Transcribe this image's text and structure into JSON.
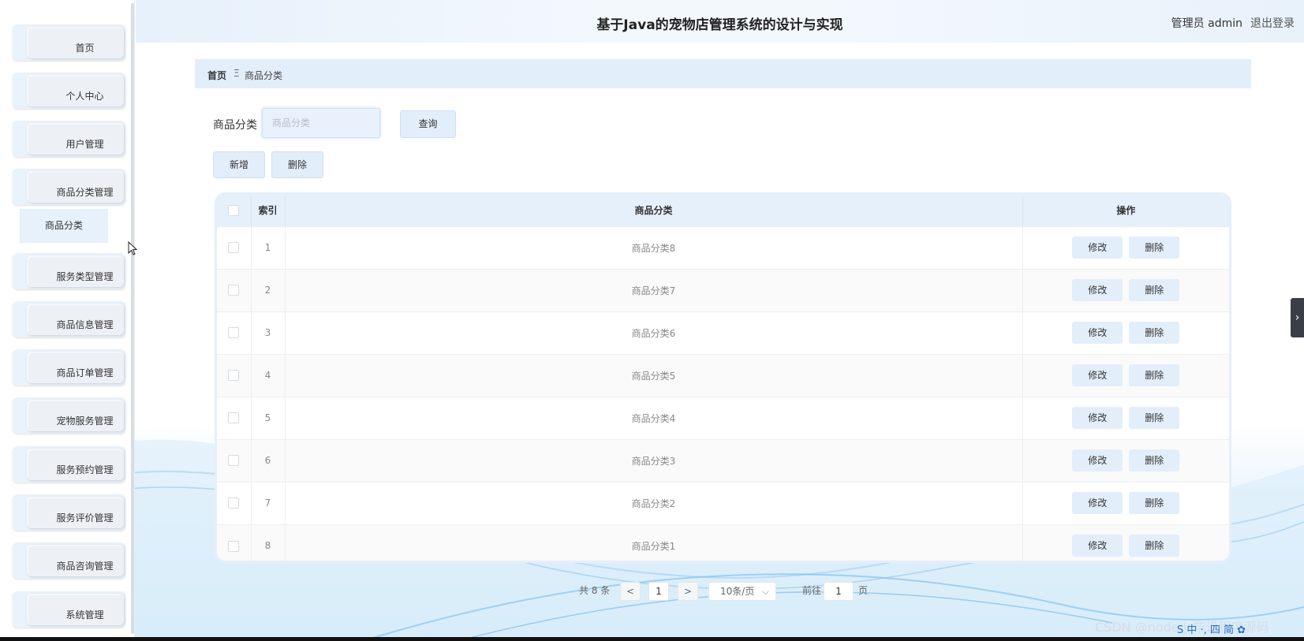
{
  "header": {
    "title": "基于Java的宠物店管理系统的设计与实现",
    "user": "管理员 admin",
    "logout": "退出登录"
  },
  "sidebar": {
    "items": [
      {
        "label": "首页"
      },
      {
        "label": "个人中心"
      },
      {
        "label": "用户管理"
      },
      {
        "label": "商品分类管理"
      },
      {
        "label": "服务类型管理"
      },
      {
        "label": "商品信息管理"
      },
      {
        "label": "商品订单管理"
      },
      {
        "label": "宠物服务管理"
      },
      {
        "label": "服务预约管理"
      },
      {
        "label": "服务评价管理"
      },
      {
        "label": "商品咨询管理"
      },
      {
        "label": "系统管理"
      }
    ],
    "submenu": {
      "label": "商品分类"
    }
  },
  "breadcrumb": {
    "home": "首页",
    "separator": "Ξ",
    "current": "商品分类"
  },
  "search": {
    "label": "商品分类",
    "placeholder": "商品分类",
    "value": "",
    "button": "查询"
  },
  "toolbar": {
    "add": "新增",
    "delete": "删除"
  },
  "table": {
    "headers": {
      "index": "索引",
      "category": "商品分类",
      "actions": "操作"
    },
    "rows": [
      {
        "index": "1",
        "category": "商品分类8"
      },
      {
        "index": "2",
        "category": "商品分类7"
      },
      {
        "index": "3",
        "category": "商品分类6"
      },
      {
        "index": "4",
        "category": "商品分类5"
      },
      {
        "index": "5",
        "category": "商品分类4"
      },
      {
        "index": "6",
        "category": "商品分类3"
      },
      {
        "index": "7",
        "category": "商品分类2"
      },
      {
        "index": "8",
        "category": "商品分类1"
      }
    ],
    "edit_label": "修改",
    "delete_label": "删除"
  },
  "pagination": {
    "total": "共 8 条",
    "prev": "<",
    "page": "1",
    "next": ">",
    "page_size": "10条/页",
    "goto_prefix": "前往",
    "goto_value": "1",
    "goto_suffix": "页"
  },
  "watermark": "CSDN @node.js毕设程序源码",
  "tray": "S 中 ·, 四 简 ✿",
  "colors": {
    "accent": "#e3eefb",
    "header_bg": "#eef5fc"
  }
}
